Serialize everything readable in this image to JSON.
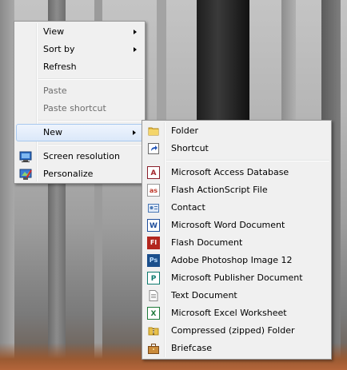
{
  "context_menu": {
    "items": [
      {
        "label": "View"
      },
      {
        "label": "Sort by"
      },
      {
        "label": "Refresh"
      },
      {
        "label": "Paste"
      },
      {
        "label": "Paste shortcut"
      },
      {
        "label": "New"
      },
      {
        "label": "Screen resolution",
        "icon": "screen-resolution-icon"
      },
      {
        "label": "Personalize",
        "icon": "personalize-icon"
      }
    ]
  },
  "new_submenu": {
    "items": [
      {
        "label": "Folder",
        "icon": "folder-icon"
      },
      {
        "label": "Shortcut",
        "icon": "shortcut-icon"
      },
      {
        "label": "Microsoft Access Database",
        "icon": "access-icon"
      },
      {
        "label": "Flash ActionScript File",
        "icon": "actionscript-icon"
      },
      {
        "label": "Contact",
        "icon": "contact-icon"
      },
      {
        "label": "Microsoft Word Document",
        "icon": "word-icon"
      },
      {
        "label": "Flash Document",
        "icon": "flash-icon"
      },
      {
        "label": "Adobe Photoshop Image 12",
        "icon": "photoshop-icon"
      },
      {
        "label": "Microsoft Publisher Document",
        "icon": "publisher-icon"
      },
      {
        "label": "Text Document",
        "icon": "text-document-icon"
      },
      {
        "label": "Microsoft Excel Worksheet",
        "icon": "excel-icon"
      },
      {
        "label": "Compressed (zipped) Folder",
        "icon": "zip-folder-icon"
      },
      {
        "label": "Briefcase",
        "icon": "briefcase-icon"
      }
    ]
  },
  "colors": {
    "menu_background": "#f0f0f0",
    "menu_border": "#979797",
    "highlight_border": "#a8c8ee",
    "disabled_text": "#6d6d6d"
  }
}
